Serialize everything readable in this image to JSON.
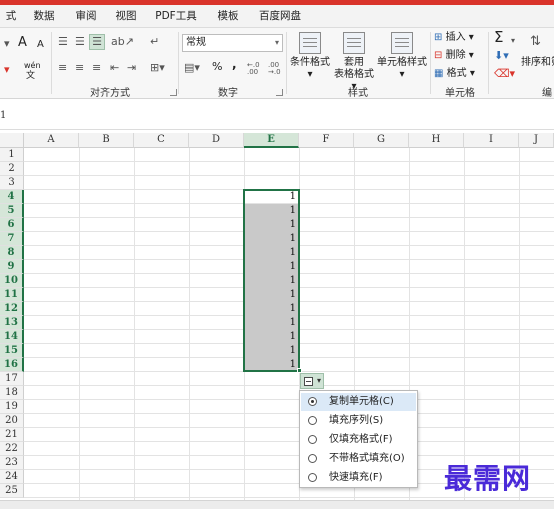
{
  "tabs": [
    "式",
    "数据",
    "审阅",
    "视图",
    "PDF工具",
    "模板",
    "百度网盘"
  ],
  "ribbon": {
    "groups": {
      "alignment": "对齐方式",
      "number": "数字",
      "styles": "样式",
      "cells": "单元格",
      "edit_partial": "编"
    },
    "number_format": "常规",
    "buttons": {
      "conditional_format": "条件格式",
      "table_format_line1": "套用",
      "table_format_line2": "表格格式",
      "cell_style": "单元格样式",
      "insert": "插入",
      "delete": "删除",
      "format": "格式",
      "sort_filter": "排序和筛"
    },
    "symbols": {
      "percent": "%",
      "comma": ",",
      "inc_decimal": "←.0 .00",
      "dec_decimal": ".00 →.0",
      "sigma": "Σ",
      "font_inc": "A",
      "font_dec": "A"
    }
  },
  "formula_bar": {
    "mark": "1"
  },
  "grid": {
    "columns": [
      "A",
      "B",
      "C",
      "D",
      "E",
      "F",
      "G",
      "H",
      "I",
      "J"
    ],
    "rows": [
      "1",
      "2",
      "3",
      "4",
      "5",
      "6",
      "7",
      "8",
      "9",
      "10",
      "11",
      "12",
      "13",
      "14",
      "15",
      "16",
      "17",
      "18",
      "19",
      "20",
      "21",
      "22",
      "23",
      "24",
      "25"
    ],
    "selected_column": "E",
    "selected_rows": [
      "4",
      "5",
      "6",
      "7",
      "8",
      "9",
      "10",
      "11",
      "12",
      "13",
      "14",
      "15",
      "16"
    ],
    "column_e_values": [
      "1",
      "1",
      "1",
      "1",
      "1",
      "1",
      "1",
      "1",
      "1",
      "1",
      "1",
      "1",
      "1"
    ]
  },
  "autofill_menu": {
    "items": [
      {
        "label": "复制单元格(C)",
        "selected": true
      },
      {
        "label": "填充序列(S)",
        "selected": false
      },
      {
        "label": "仅填充格式(F)",
        "selected": false
      },
      {
        "label": "不带格式填充(O)",
        "selected": false
      },
      {
        "label": "快速填充(F)",
        "selected": false
      }
    ]
  },
  "watermark": "最需网",
  "colors": {
    "accent_green": "#217346",
    "selection_fill": "#c9c9c9",
    "watermark": "#4a2ad8"
  }
}
